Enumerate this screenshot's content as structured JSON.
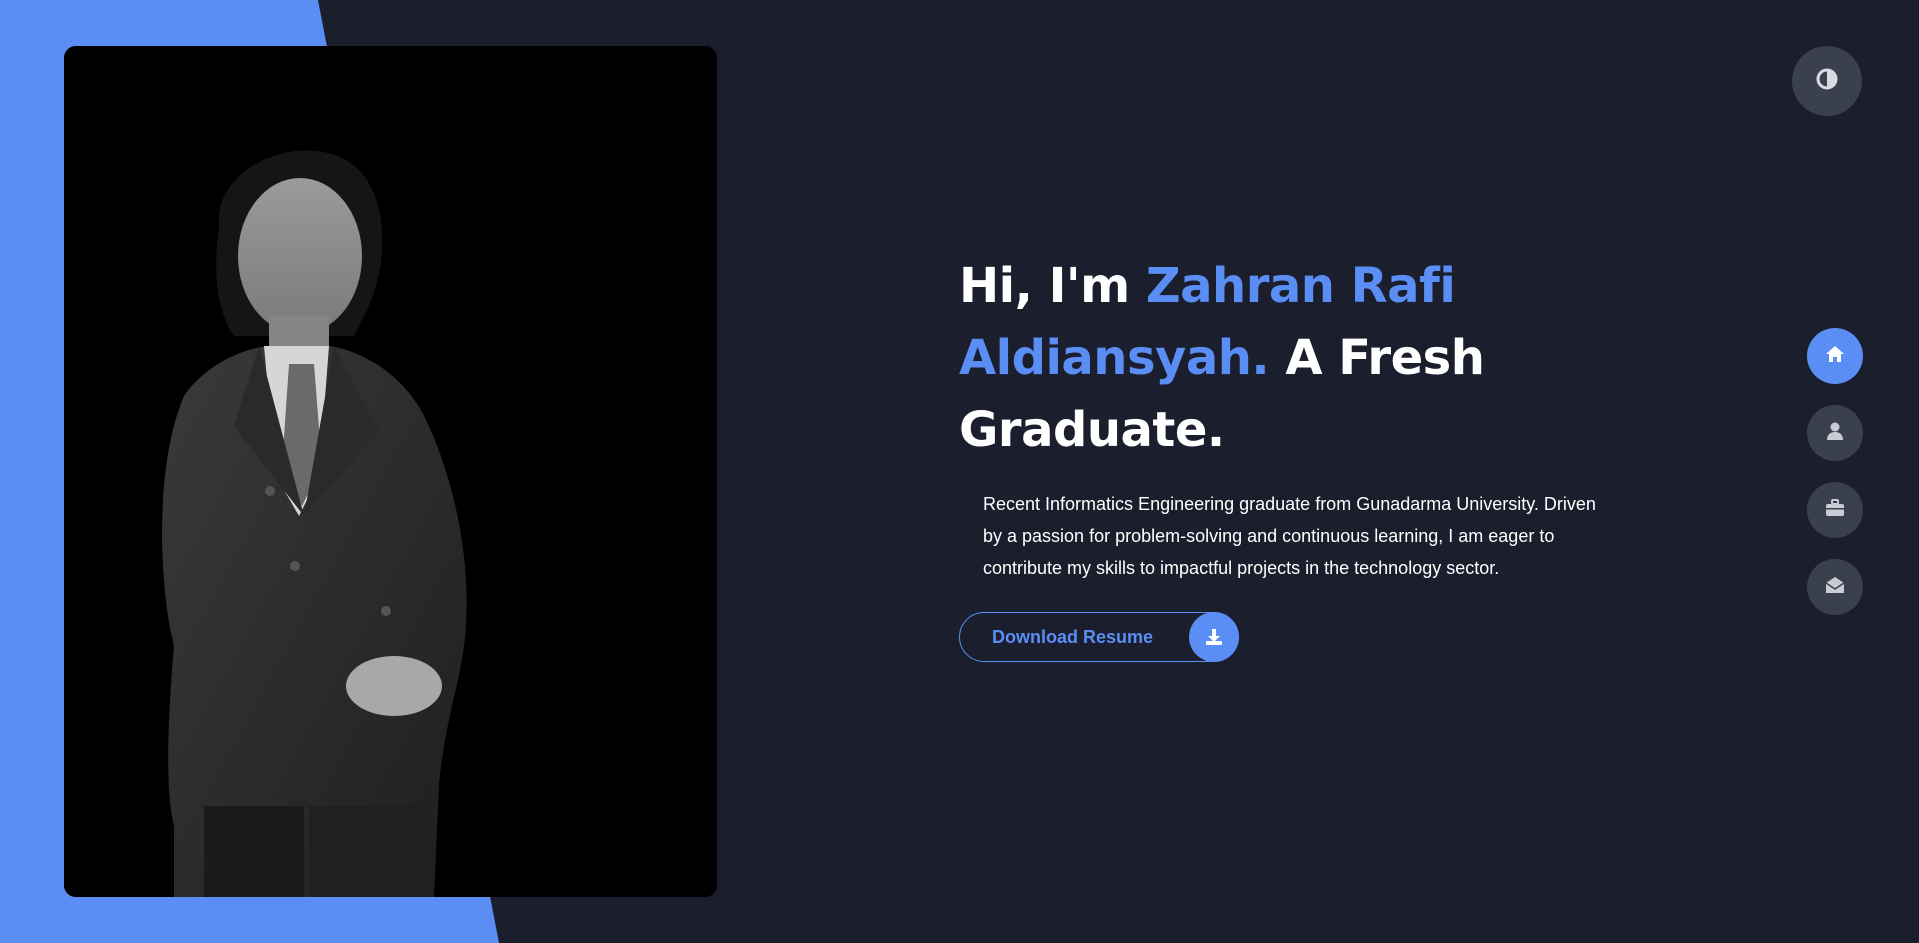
{
  "hero": {
    "greeting": "Hi, I'm ",
    "name": "Zahran Rafi Aldiansyah.",
    "tagline": " A Fresh Graduate.",
    "description": "Recent Informatics Engineering graduate from Gunadarma University. Driven by a passion for problem-solving and continuous learning, I am eager to contribute my skills to impactful projects in the technology sector.",
    "resume_button_label": "Download Resume"
  },
  "colors": {
    "accent": "#5a8ef5",
    "background": "#1b1e2c",
    "nav_button": "#3a404d"
  },
  "icons": {
    "theme_toggle": "half-circle-contrast-icon",
    "download": "download-icon",
    "nav": [
      "home-icon",
      "user-icon",
      "briefcase-icon",
      "envelope-open-icon"
    ]
  },
  "side_nav": {
    "active_index": 0
  }
}
